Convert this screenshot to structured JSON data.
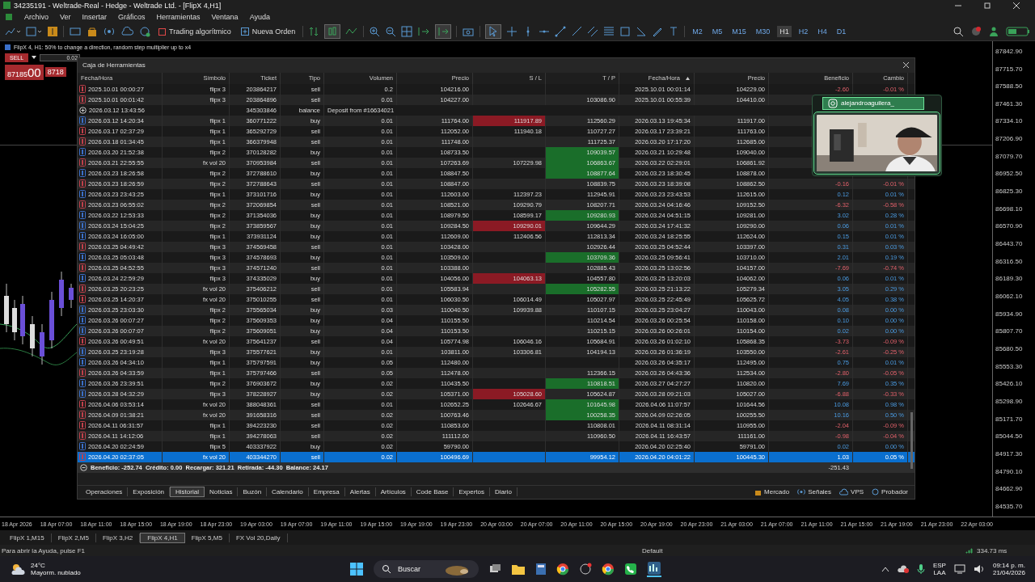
{
  "window": {
    "title": "34235191 - Weltrade-Real - Hedge - Weltrade Ltd. - [FlipX 4,H1]"
  },
  "menu": [
    "Archivo",
    "Ver",
    "Insertar",
    "Gráficos",
    "Herramientas",
    "Ventana",
    "Ayuda"
  ],
  "toolbar": {
    "algo_trading": "Trading algorítmico",
    "new_order": "Nueva Orden",
    "timeframes": [
      {
        "label": "M2",
        "selected": false
      },
      {
        "label": "M5",
        "selected": false
      },
      {
        "label": "M15",
        "selected": false
      },
      {
        "label": "M30",
        "selected": false
      },
      {
        "label": "H1",
        "selected": true
      },
      {
        "label": "H2",
        "selected": false
      },
      {
        "label": "H4",
        "selected": false
      },
      {
        "label": "D1",
        "selected": false
      }
    ]
  },
  "chart": {
    "header": "FlipX 4, H1: 50% to change a direction, random step multiplier up to x4",
    "trade_panel": {
      "sell": "SELL",
      "volume": "0.02",
      "bid_main": "87185",
      "bid_small": "00",
      "ask_main": "8718"
    },
    "price_axis": [
      "87842.90",
      "87715.70",
      "87588.50",
      "87461.30",
      "87334.10",
      "87206.90",
      "87079.70",
      "86952.50",
      "86825.30",
      "86698.10",
      "86570.90",
      "86443.70",
      "86316.50",
      "86189.30",
      "86062.10",
      "85934.90",
      "85807.70",
      "85680.50",
      "85553.30",
      "85426.10",
      "85298.90",
      "85171.70",
      "85044.50",
      "84917.30",
      "84790.10",
      "84662.90",
      "84535.70"
    ],
    "time_axis": [
      "18 Apr 2026",
      "18 Apr 07:00",
      "18 Apr 11:00",
      "18 Apr 15:00",
      "18 Apr 19:00",
      "18 Apr 23:00",
      "19 Apr 03:00",
      "19 Apr 07:00",
      "19 Apr 11:00",
      "19 Apr 15:00",
      "19 Apr 19:00",
      "19 Apr 23:00",
      "20 Apr 03:00",
      "20 Apr 07:00",
      "20 Apr 11:00",
      "20 Apr 15:00",
      "20 Apr 19:00",
      "20 Apr 23:00",
      "21 Apr 03:00",
      "21 Apr 07:00",
      "21 Apr 11:00",
      "21 Apr 15:00",
      "21 Apr 19:00",
      "21 Apr 23:00",
      "22 Apr 03:00"
    ]
  },
  "toolbox": {
    "title": "Caja de Herramientas",
    "columns": [
      {
        "label": "Fecha/Hora",
        "sorted": false
      },
      {
        "label": "Símbolo",
        "sorted": false
      },
      {
        "label": "Ticket",
        "sorted": false
      },
      {
        "label": "Tipo",
        "sorted": false
      },
      {
        "label": "Volumen",
        "sorted": false
      },
      {
        "label": "Precio",
        "sorted": false
      },
      {
        "label": "S / L",
        "sorted": false
      },
      {
        "label": "T / P",
        "sorted": false
      },
      {
        "label": "Fecha/Hora",
        "sorted": true
      },
      {
        "label": "Precio",
        "sorted": false
      },
      {
        "label": "Beneficio",
        "sorted": false
      },
      {
        "label": "Cambio",
        "sorted": false
      }
    ],
    "rows": [
      {
        "kind": "trade",
        "color": "#c0404a",
        "opened": "2025.10.01 00:00:27",
        "symbol": "flipx 3",
        "ticket": "203864217",
        "type": "sell",
        "volume": "0.2",
        "price": "104216.00",
        "sl_hit": false,
        "tp_hit": false,
        "closed": "2025.10.01 00:01:14",
        "close_price": "104229.00",
        "profit": "-2.60",
        "change": "-0.01 %",
        "loss": true,
        "selected": false
      },
      {
        "kind": "trade",
        "color": "#c0404a",
        "opened": "2025.10.01 00:01:42",
        "symbol": "flipx 3",
        "ticket": "203864896",
        "type": "sell",
        "volume": "0.01",
        "price": "104227.00",
        "tp": "103086.90",
        "sl_hit": false,
        "tp_hit": false,
        "closed": "2025.10.01 00:55:39",
        "close_price": "104410.00",
        "selected": false
      },
      {
        "kind": "balance",
        "opened": "2026.03.12 13:43:56",
        "ticket": "345303846",
        "type": "balance",
        "comment": "Deposit from #16634021",
        "selected": false
      },
      {
        "kind": "trade",
        "color": "#3a6fc8",
        "opened": "2026.03.12 14:20:34",
        "symbol": "flipx 1",
        "ticket": "360771222",
        "type": "buy",
        "volume": "0.01",
        "price": "111764.00",
        "sl": "111917.89",
        "tp": "112560.29",
        "sl_hit": true,
        "tp_hit": false,
        "closed": "2026.03.13 19:45:34",
        "close_price": "111917.00",
        "selected": false
      },
      {
        "kind": "trade",
        "color": "#c0404a",
        "opened": "2026.03.17 02:37:29",
        "symbol": "flipx 1",
        "ticket": "365292729",
        "type": "sell",
        "volume": "0.01",
        "price": "112052.00",
        "sl": "111940.18",
        "tp": "110727.27",
        "sl_hit": false,
        "tp_hit": false,
        "closed": "2026.03.17 23:39:21",
        "close_price": "111763.00",
        "selected": false
      },
      {
        "kind": "trade",
        "color": "#c0404a",
        "opened": "2026.03.18 01:34:45",
        "symbol": "flipx 1",
        "ticket": "366379948",
        "type": "sell",
        "volume": "0.01",
        "price": "111748.00",
        "tp": "111725.37",
        "sl_hit": false,
        "tp_hit": false,
        "closed": "2026.03.20 17:17:20",
        "close_price": "112685.00",
        "selected": false
      },
      {
        "kind": "trade",
        "color": "#3a6fc8",
        "opened": "2026.03.20 21:52:38",
        "symbol": "flipx 2",
        "ticket": "370128282",
        "type": "buy",
        "volume": "0.01",
        "price": "108733.50",
        "tp": "109039.57",
        "sl_hit": false,
        "tp_hit": true,
        "closed": "2026.03.21 10:29:48",
        "close_price": "109040.00",
        "selected": false
      },
      {
        "kind": "trade",
        "color": "#c0404a",
        "opened": "2026.03.21 22:55:55",
        "symbol": "fx vol 20",
        "ticket": "370953984",
        "type": "sell",
        "volume": "0.01",
        "price": "107263.69",
        "sl": "107229.98",
        "tp": "106863.67",
        "sl_hit": false,
        "tp_hit": true,
        "closed": "2026.03.22 02:29:01",
        "close_price": "106861.92",
        "selected": false
      },
      {
        "kind": "trade",
        "color": "#3a6fc8",
        "opened": "2026.03.23 18:26:58",
        "symbol": "flipx 2",
        "ticket": "372788610",
        "type": "buy",
        "volume": "0.01",
        "price": "108847.50",
        "tp": "108877.64",
        "sl_hit": false,
        "tp_hit": true,
        "closed": "2026.03.23 18:30:45",
        "close_price": "108878.00",
        "selected": false
      },
      {
        "kind": "trade",
        "color": "#c0404a",
        "opened": "2026.03.23 18:26:59",
        "symbol": "flipx 2",
        "ticket": "372788643",
        "type": "sell",
        "volume": "0.01",
        "price": "108847.00",
        "tp": "108839.75",
        "sl_hit": false,
        "tp_hit": false,
        "closed": "2026.03.23 18:39:08",
        "close_price": "108862.50",
        "profit": "-0.16",
        "change": "-0.01 %",
        "loss": true,
        "selected": false
      },
      {
        "kind": "trade",
        "color": "#3a6fc8",
        "opened": "2026.03.23 23:43:25",
        "symbol": "flipx 1",
        "ticket": "373101716",
        "type": "buy",
        "volume": "0.01",
        "price": "112603.00",
        "sl": "112397.23",
        "tp": "112945.91",
        "sl_hit": false,
        "tp_hit": false,
        "closed": "2026.03.23 23:43:53",
        "close_price": "112615.00",
        "profit": "0.12",
        "change": "0.01 %",
        "loss": false,
        "selected": false
      },
      {
        "kind": "trade",
        "color": "#c0404a",
        "opened": "2026.03.23 06:55:02",
        "symbol": "flipx 2",
        "ticket": "372069854",
        "type": "sell",
        "volume": "0.01",
        "price": "108521.00",
        "sl": "109290.79",
        "tp": "108207.71",
        "sl_hit": false,
        "tp_hit": false,
        "closed": "2026.03.24 04:16:46",
        "close_price": "109152.50",
        "profit": "-6.32",
        "change": "-0.58 %",
        "loss": true,
        "selected": false
      },
      {
        "kind": "trade",
        "color": "#3a6fc8",
        "opened": "2026.03.22 12:53:33",
        "symbol": "flipx 2",
        "ticket": "371354036",
        "type": "buy",
        "volume": "0.01",
        "price": "108979.50",
        "sl": "108599.17",
        "tp": "109280.93",
        "sl_hit": false,
        "tp_hit": true,
        "closed": "2026.03.24 04:51:15",
        "close_price": "109281.00",
        "profit": "3.02",
        "change": "0.28 %",
        "loss": false,
        "selected": false
      },
      {
        "kind": "trade",
        "color": "#3a6fc8",
        "opened": "2026.03.24 15:04:25",
        "symbol": "flipx 2",
        "ticket": "373859567",
        "type": "buy",
        "volume": "0.01",
        "price": "109284.50",
        "sl": "109290.01",
        "tp": "109644.29",
        "sl_hit": true,
        "tp_hit": false,
        "closed": "2026.03.24 17:41:32",
        "close_price": "109290.00",
        "profit": "0.06",
        "change": "0.01 %",
        "loss": false,
        "selected": false
      },
      {
        "kind": "trade",
        "color": "#3a6fc8",
        "opened": "2026.03.24 16:05:00",
        "symbol": "flipx 1",
        "ticket": "373931124",
        "type": "buy",
        "volume": "0.01",
        "price": "112609.00",
        "sl": "112406.56",
        "tp": "112813.34",
        "sl_hit": false,
        "tp_hit": false,
        "closed": "2026.03.24 18:25:55",
        "close_price": "112624.00",
        "profit": "0.15",
        "change": "0.01 %",
        "loss": false,
        "selected": false
      },
      {
        "kind": "trade",
        "color": "#c0404a",
        "opened": "2026.03.25 04:49:42",
        "symbol": "flipx 3",
        "ticket": "374569458",
        "type": "sell",
        "volume": "0.01",
        "price": "103428.00",
        "tp": "102926.44",
        "sl_hit": false,
        "tp_hit": false,
        "closed": "2026.03.25 04:52:44",
        "close_price": "103397.00",
        "profit": "0.31",
        "change": "0.03 %",
        "loss": false,
        "selected": false
      },
      {
        "kind": "trade",
        "color": "#3a6fc8",
        "opened": "2026.03.25 05:03:48",
        "symbol": "flipx 3",
        "ticket": "374578693",
        "type": "buy",
        "volume": "0.01",
        "price": "103509.00",
        "tp": "103709.36",
        "sl_hit": false,
        "tp_hit": true,
        "closed": "2026.03.25 09:56:41",
        "close_price": "103710.00",
        "profit": "2.01",
        "change": "0.19 %",
        "loss": false,
        "selected": false
      },
      {
        "kind": "trade",
        "color": "#c0404a",
        "opened": "2026.03.25 04:52:55",
        "symbol": "flipx 3",
        "ticket": "374571240",
        "type": "sell",
        "volume": "0.01",
        "price": "103388.00",
        "tp": "102885.43",
        "sl_hit": false,
        "tp_hit": false,
        "closed": "2026.03.25 13:02:56",
        "close_price": "104157.00",
        "profit": "-7.69",
        "change": "-0.74 %",
        "loss": true,
        "selected": false
      },
      {
        "kind": "trade",
        "color": "#3a6fc8",
        "opened": "2026.03.24 22:59:29",
        "symbol": "flipx 3",
        "ticket": "374335029",
        "type": "buy",
        "volume": "0.01",
        "price": "104056.00",
        "sl": "104063.13",
        "tp": "104557.80",
        "sl_hit": true,
        "tp_hit": false,
        "closed": "2026.03.25 13:20:03",
        "close_price": "104062.00",
        "profit": "0.06",
        "change": "0.01 %",
        "loss": false,
        "selected": false
      },
      {
        "kind": "trade",
        "color": "#c0404a",
        "opened": "2026.03.25 20:23:25",
        "symbol": "fx vol 20",
        "ticket": "375406212",
        "type": "sell",
        "volume": "0.01",
        "price": "105583.94",
        "tp": "105282.55",
        "sl_hit": false,
        "tp_hit": true,
        "closed": "2026.03.25 21:13:22",
        "close_price": "105279.34",
        "profit": "3.05",
        "change": "0.29 %",
        "loss": false,
        "selected": false
      },
      {
        "kind": "trade",
        "color": "#c0404a",
        "opened": "2026.03.25 14:20:37",
        "symbol": "fx vol 20",
        "ticket": "375010255",
        "type": "sell",
        "volume": "0.01",
        "price": "106030.50",
        "sl": "106014.49",
        "tp": "105027.97",
        "sl_hit": false,
        "tp_hit": false,
        "closed": "2026.03.25 22:45:49",
        "close_price": "105625.72",
        "profit": "4.05",
        "change": "0.38 %",
        "loss": false,
        "selected": false
      },
      {
        "kind": "trade",
        "color": "#3a6fc8",
        "opened": "2026.03.25 23:03:30",
        "symbol": "flipx 2",
        "ticket": "375565034",
        "type": "buy",
        "volume": "0.03",
        "price": "110040.50",
        "sl": "109939.88",
        "tp": "110107.15",
        "sl_hit": false,
        "tp_hit": false,
        "closed": "2026.03.25 23:04:27",
        "close_price": "110043.00",
        "profit": "0.08",
        "change": "0.00 %",
        "loss": false,
        "selected": false
      },
      {
        "kind": "trade",
        "color": "#3a6fc8",
        "opened": "2026.03.26 00:07:27",
        "symbol": "flipx 2",
        "ticket": "375609353",
        "type": "buy",
        "volume": "0.04",
        "price": "110155.50",
        "tp": "110214.54",
        "sl_hit": false,
        "tp_hit": false,
        "closed": "2026.03.26 00:25:54",
        "close_price": "110158.00",
        "profit": "0.10",
        "change": "0.00 %",
        "loss": false,
        "selected": false
      },
      {
        "kind": "trade",
        "color": "#3a6fc8",
        "opened": "2026.03.26 00:07:07",
        "symbol": "flipx 2",
        "ticket": "375609051",
        "type": "buy",
        "volume": "0.04",
        "price": "110153.50",
        "tp": "110215.15",
        "sl_hit": false,
        "tp_hit": false,
        "closed": "2026.03.26 00:26:01",
        "close_price": "110154.00",
        "profit": "0.02",
        "change": "0.00 %",
        "loss": false,
        "selected": false
      },
      {
        "kind": "trade",
        "color": "#c0404a",
        "opened": "2026.03.26 00:49:51",
        "symbol": "fx vol 20",
        "ticket": "375641237",
        "type": "sell",
        "volume": "0.04",
        "price": "105774.98",
        "sl": "106046.16",
        "tp": "105684.91",
        "sl_hit": false,
        "tp_hit": false,
        "closed": "2026.03.26 01:02:10",
        "close_price": "105868.35",
        "profit": "-3.73",
        "change": "-0.09 %",
        "loss": true,
        "selected": false
      },
      {
        "kind": "trade",
        "color": "#3a6fc8",
        "opened": "2026.03.25 23:19:28",
        "symbol": "flipx 3",
        "ticket": "375577621",
        "type": "buy",
        "volume": "0.01",
        "price": "103811.00",
        "sl": "103306.81",
        "tp": "104194.13",
        "sl_hit": false,
        "tp_hit": false,
        "closed": "2026.03.26 01:36:19",
        "close_price": "103550.00",
        "profit": "-2.61",
        "change": "-0.25 %",
        "loss": true,
        "selected": false
      },
      {
        "kind": "trade",
        "color": "#3a6fc8",
        "opened": "2026.03.26 04:34:10",
        "symbol": "flipx 1",
        "ticket": "375797591",
        "type": "buy",
        "volume": "0.05",
        "price": "112480.00",
        "sl_hit": false,
        "tp_hit": false,
        "closed": "2026.03.26 04:35:17",
        "close_price": "112495.00",
        "profit": "0.75",
        "change": "0.01 %",
        "loss": false,
        "selected": false
      },
      {
        "kind": "trade",
        "color": "#c0404a",
        "opened": "2026.03.26 04:33:59",
        "symbol": "flipx 1",
        "ticket": "375797466",
        "type": "sell",
        "volume": "0.05",
        "price": "112478.00",
        "tp": "112366.15",
        "sl_hit": false,
        "tp_hit": false,
        "closed": "2026.03.26 04:43:36",
        "close_price": "112534.00",
        "profit": "-2.80",
        "change": "-0.05 %",
        "loss": true,
        "selected": false
      },
      {
        "kind": "trade",
        "color": "#3a6fc8",
        "opened": "2026.03.26 23:39:51",
        "symbol": "flipx 2",
        "ticket": "376903672",
        "type": "buy",
        "volume": "0.02",
        "price": "110435.50",
        "tp": "110818.51",
        "sl_hit": false,
        "tp_hit": true,
        "closed": "2026.03.27 04:27:27",
        "close_price": "110820.00",
        "profit": "7.69",
        "change": "0.35 %",
        "loss": false,
        "selected": false
      },
      {
        "kind": "trade",
        "color": "#3a6fc8",
        "opened": "2026.03.28 04:32:29",
        "symbol": "flipx 3",
        "ticket": "378228927",
        "type": "buy",
        "volume": "0.02",
        "price": "105371.00",
        "sl": "105028.60",
        "tp": "105624.87",
        "sl_hit": true,
        "tp_hit": false,
        "closed": "2026.03.28 09:21:03",
        "close_price": "105027.00",
        "profit": "-6.88",
        "change": "-0.33 %",
        "loss": true,
        "selected": false
      },
      {
        "kind": "trade",
        "color": "#c0404a",
        "opened": "2026.04.06 03:53:14",
        "symbol": "fx vol 20",
        "ticket": "388048361",
        "type": "sell",
        "volume": "0.01",
        "price": "102652.25",
        "sl": "102646.67",
        "tp": "101645.98",
        "sl_hit": false,
        "tp_hit": true,
        "closed": "2026.04.06 11:07:57",
        "close_price": "101644.56",
        "profit": "10.08",
        "change": "0.98 %",
        "loss": false,
        "selected": false
      },
      {
        "kind": "trade",
        "color": "#c0404a",
        "opened": "2026.04.09 01:38:21",
        "symbol": "fx vol 20",
        "ticket": "391658316",
        "type": "sell",
        "volume": "0.02",
        "price": "100763.46",
        "tp": "100258.35",
        "sl_hit": false,
        "tp_hit": true,
        "closed": "2026.04.09 02:26:05",
        "close_price": "100255.50",
        "profit": "10.16",
        "change": "0.50 %",
        "loss": false,
        "selected": false
      },
      {
        "kind": "trade",
        "color": "#c0404a",
        "opened": "2026.04.11 06:31:57",
        "symbol": "flipx 1",
        "ticket": "394223230",
        "type": "sell",
        "volume": "0.02",
        "price": "110853.00",
        "tp": "110808.01",
        "sl_hit": false,
        "tp_hit": false,
        "closed": "2026.04.11 08:31:14",
        "close_price": "110955.00",
        "profit": "-2.04",
        "change": "-0.09 %",
        "loss": true,
        "selected": false
      },
      {
        "kind": "trade",
        "color": "#c0404a",
        "opened": "2026.04.11 14:12:06",
        "symbol": "flipx 1",
        "ticket": "394278063",
        "type": "sell",
        "volume": "0.02",
        "price": "111112.00",
        "tp": "110960.50",
        "sl_hit": false,
        "tp_hit": false,
        "closed": "2026.04.11 16:43:57",
        "close_price": "111161.00",
        "profit": "-0.98",
        "change": "-0.04 %",
        "loss": true,
        "selected": false
      },
      {
        "kind": "trade",
        "color": "#3a6fc8",
        "opened": "2026.04.20 02:24:59",
        "symbol": "flipx 5",
        "ticket": "403337922",
        "type": "buy",
        "volume": "0.02",
        "price": "59790.00",
        "sl_hit": false,
        "tp_hit": false,
        "closed": "2026.04.20 02:25:40",
        "close_price": "59791.00",
        "profit": "0.02",
        "change": "0.00 %",
        "loss": false,
        "selected": false
      },
      {
        "kind": "trade",
        "color": "#c0404a",
        "opened": "2026.04.20 02:37:05",
        "symbol": "fx vol 20",
        "ticket": "403344270",
        "type": "sell",
        "volume": "0.02",
        "price": "100496.69",
        "tp": "99954.12",
        "sl_hit": false,
        "tp_hit": false,
        "closed": "2026.04.20 04:01:22",
        "close_price": "100445.30",
        "profit": "1.03",
        "change": "0.05 %",
        "loss": false,
        "selected": true
      }
    ],
    "summary": "Beneficio: -252.74  Crédito: 0.00  Recargar: 321.21  Retirada: -44.30  Balance: 24.17",
    "total_profit": "-251.43",
    "tabs": [
      {
        "label": "Operaciones",
        "selected": false
      },
      {
        "label": "Exposición",
        "selected": false
      },
      {
        "label": "Historial",
        "selected": true
      },
      {
        "label": "Noticias",
        "selected": false
      },
      {
        "label": "Buzón",
        "selected": false
      },
      {
        "label": "Calendario",
        "selected": false
      },
      {
        "label": "Empresa",
        "selected": false
      },
      {
        "label": "Alertas",
        "selected": false
      },
      {
        "label": "Artículos",
        "selected": false
      },
      {
        "label": "Code Base",
        "selected": false
      },
      {
        "label": "Expertos",
        "selected": false
      },
      {
        "label": "Diario",
        "selected": false
      }
    ],
    "links": [
      "Mercado",
      "Señales",
      "VPS",
      "Probador"
    ]
  },
  "stream_overlay": {
    "handle": "alejandroaguilera_"
  },
  "chart_tabs": [
    {
      "label": "FlipX 1,M15",
      "selected": false
    },
    {
      "label": "FlipX 2,M5",
      "selected": false
    },
    {
      "label": "FlipX 3,H2",
      "selected": false
    },
    {
      "label": "FlipX 4,H1",
      "selected": true
    },
    {
      "label": "FlipX 5,M5",
      "selected": false
    },
    {
      "label": "FX Vol 20,Daily",
      "selected": false
    }
  ],
  "status_bar": {
    "help": "Para abrir la Ayuda, pulse F1",
    "profile": "Default",
    "ping": "334.73 ms"
  },
  "taskbar": {
    "temperature": "24°C",
    "weather": "Mayorm. nublado",
    "search": "Buscar",
    "language": "ESP",
    "layout": "LAA",
    "time": "09:14 p. m.",
    "date": "21/04/2026"
  }
}
